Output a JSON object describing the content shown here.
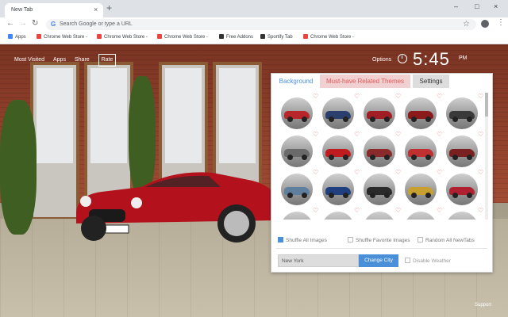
{
  "browser": {
    "tab_title": "New Tab",
    "tab_close": "×",
    "new_tab": "+",
    "window_controls": {
      "minimize": "–",
      "maximize": "□",
      "close": "×"
    },
    "omnibox_placeholder": "Search Google or type a URL",
    "omnibox_icon": "G"
  },
  "bookmarks": [
    {
      "label": "Apps",
      "icon": "apps-grid-icon",
      "color": "#4285f4"
    },
    {
      "label": "Chrome Web Store -",
      "icon": "chrome-web-store-icon",
      "color": "#e8453c"
    },
    {
      "label": "Chrome Web Store -",
      "icon": "chrome-web-store-icon",
      "color": "#e8453c"
    },
    {
      "label": "Chrome Web Store -",
      "icon": "chrome-web-store-icon",
      "color": "#e8453c"
    },
    {
      "label": "Free Addons",
      "icon": "addons-icon",
      "color": "#333333"
    },
    {
      "label": "Sportify Tab",
      "icon": "sportify-icon",
      "color": "#333333"
    },
    {
      "label": "Chrome Web Store -",
      "icon": "chrome-web-store-icon",
      "color": "#e8453c"
    }
  ],
  "newtab": {
    "links": [
      "Most Visited",
      "Apps",
      "Share"
    ],
    "rate": "Rate",
    "options": "Options",
    "time": "5:45",
    "ampm": "PM",
    "support": "Support"
  },
  "panel": {
    "tabs": {
      "background": "Background",
      "related": "Must-have Related Themes",
      "settings": "Settings"
    },
    "thumb_colors": [
      "#b8262b",
      "#2a3f6b",
      "#a01e24",
      "#8c1a1a",
      "#3a3a3a",
      "#6a6a6a",
      "#c01c20",
      "#8a2a2a",
      "#c03030",
      "#7a2020",
      "#5f7f9f",
      "#1f3f7f",
      "#2a2a2a",
      "#c8a030",
      "#b02030",
      "#8a2222",
      "#9aa8b8",
      "#5a5a5a",
      "#a02424",
      "#707070"
    ],
    "heart": "♡",
    "options": [
      {
        "label": "Shuffle All Images",
        "checked": true
      },
      {
        "label": "Shuffle Favorite Images",
        "checked": false
      },
      {
        "label": "Random All NewTabs",
        "checked": false
      }
    ],
    "city_value": "New York",
    "change_city": "Change City",
    "disable_weather": "Disable Weather"
  },
  "colors": {
    "accent": "#4a90d9",
    "related_tab": "#e05a5a",
    "brick": "#9a4630"
  }
}
